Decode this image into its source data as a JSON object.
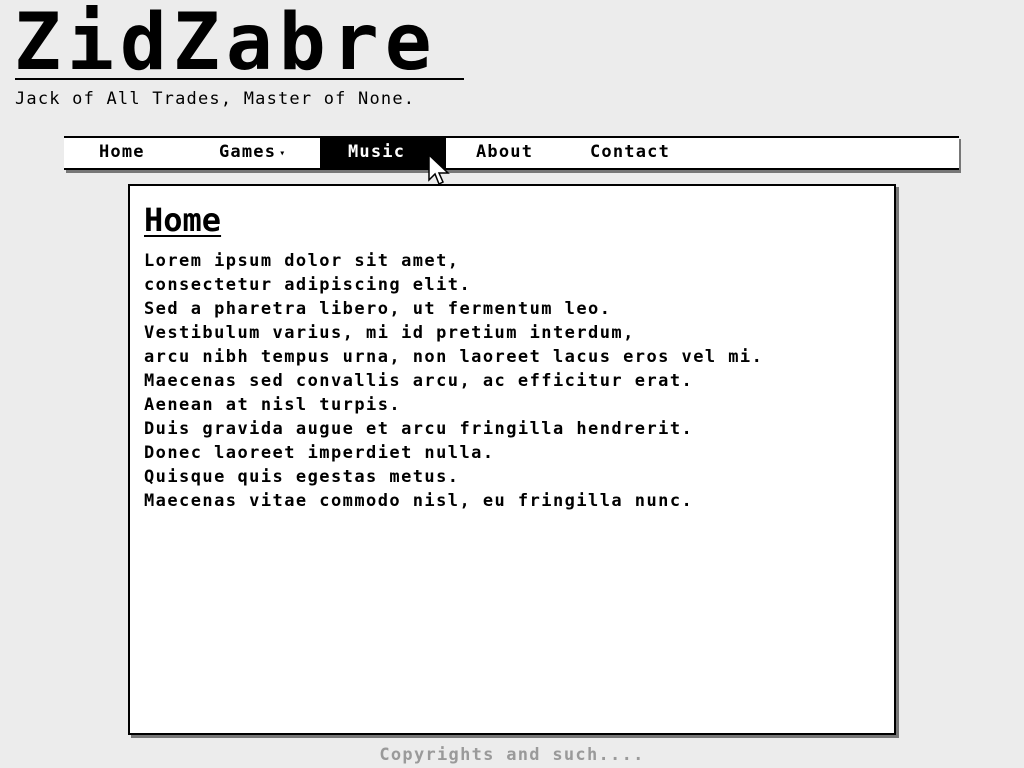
{
  "header": {
    "site_title": "ZidZabre",
    "tagline": "Jack of All Trades, Master of None."
  },
  "nav": {
    "items": [
      {
        "label": "Home",
        "active": false
      },
      {
        "label": "Games",
        "active": false,
        "has_dropdown": true,
        "dropdown_icon": "caret-down-icon"
      },
      {
        "label": "Music",
        "active": true
      },
      {
        "label": "About",
        "active": false
      },
      {
        "label": "Contact",
        "active": false
      }
    ]
  },
  "content": {
    "heading": "Home",
    "lines": [
      "Lorem ipsum dolor sit amet,",
      "consectetur adipiscing elit.",
      "Sed a pharetra libero, ut fermentum leo.",
      "Vestibulum varius, mi id pretium interdum,",
      "arcu nibh tempus urna, non laoreet lacus eros vel mi.",
      "Maecenas sed convallis arcu, ac efficitur erat.",
      "Aenean at nisl turpis.",
      "Duis gravida augue et arcu fringilla hendrerit.",
      "Donec laoreet imperdiet nulla.",
      "Quisque quis egestas metus.",
      "Maecenas vitae commodo nisl, eu fringilla nunc."
    ]
  },
  "footer": {
    "text": "Copyrights and such...."
  },
  "colors": {
    "background": "#ececec",
    "panel": "#ffffff",
    "ink": "#000000",
    "footer_text": "#9a9a9a"
  },
  "cursor": {
    "icon": "mouse-pointer-icon"
  }
}
